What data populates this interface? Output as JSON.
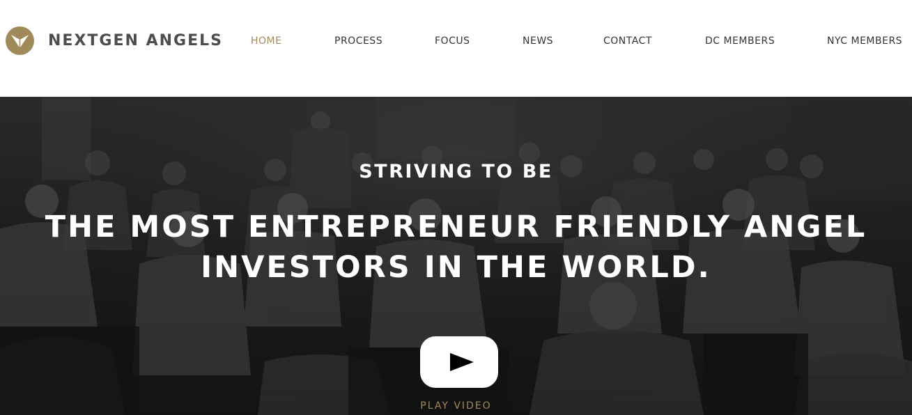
{
  "brand": {
    "name": "NEXTGEN ANGELS",
    "accent_color": "#a08a5a",
    "text_color": "#4d4d4d"
  },
  "nav": {
    "items": [
      {
        "label": "HOME",
        "active": true
      },
      {
        "label": "PROCESS",
        "active": false
      },
      {
        "label": "FOCUS",
        "active": false
      },
      {
        "label": "NEWS",
        "active": false
      },
      {
        "label": "CONTACT",
        "active": false
      },
      {
        "label": "DC MEMBERS",
        "active": false
      },
      {
        "label": "NYC MEMBERS",
        "active": false
      }
    ]
  },
  "hero": {
    "subtitle": "STRIVING TO BE",
    "headline_line1": "THE MOST ENTREPRENEUR FRIENDLY ANGEL",
    "headline_line2": "INVESTORS IN THE WORLD.",
    "play_label": "PLAY VIDEO",
    "background": "grayscale-photo-of-seated-audience"
  }
}
